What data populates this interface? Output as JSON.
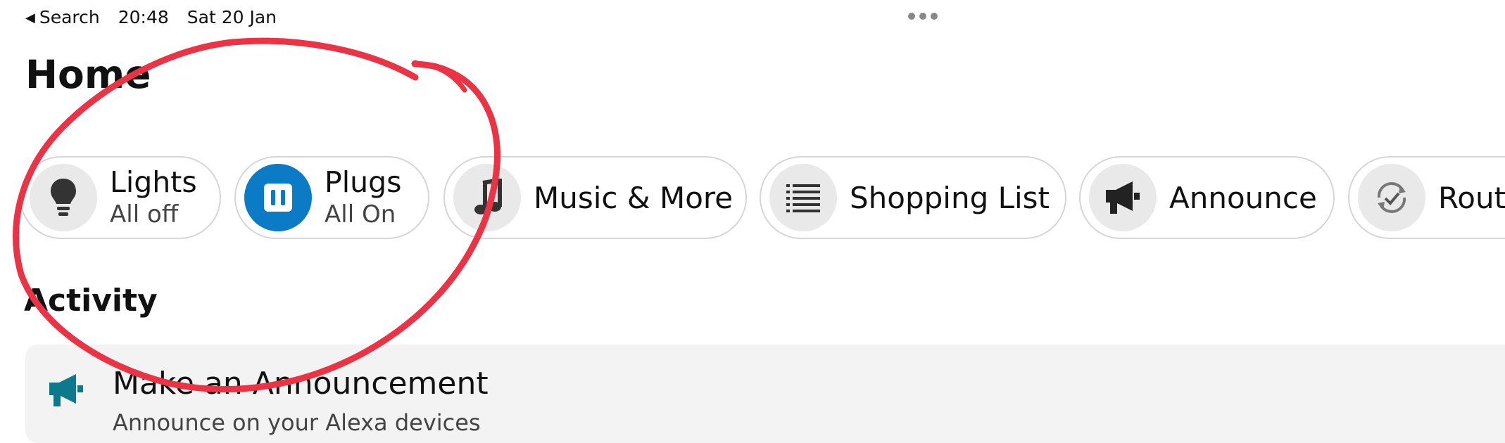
{
  "status": {
    "back": "Search",
    "time": "20:48",
    "date": "Sat 20 Jan"
  },
  "page": {
    "title": "Home"
  },
  "chips": [
    {
      "label": "Lights",
      "sub": "All off",
      "icon": "lightbulb-icon"
    },
    {
      "label": "Plugs",
      "sub": "All On",
      "icon": "plug-icon"
    },
    {
      "label": "Music & More",
      "icon": "music-note-icon"
    },
    {
      "label": "Shopping List",
      "icon": "list-icon"
    },
    {
      "label": "Announce",
      "icon": "megaphone-icon"
    },
    {
      "label": "Routi",
      "icon": "routine-icon"
    }
  ],
  "activity": {
    "title": "Activity",
    "card": {
      "title": "Make an Announcement",
      "subtitle": "Announce on your Alexa devices",
      "icon": "megaphone-icon"
    }
  },
  "colors": {
    "plug_accent": "#0a7bc4",
    "announcement_teal": "#0c7a8c",
    "annotation": "#ea3344"
  }
}
